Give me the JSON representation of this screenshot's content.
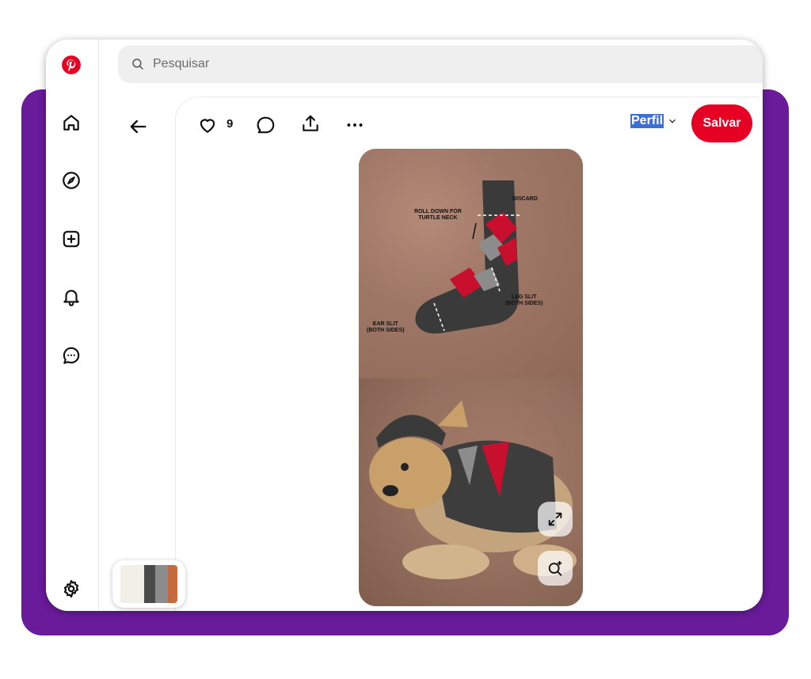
{
  "app": {
    "name": "Pinterest",
    "brand_color": "#e60023",
    "frame_color": "#6a1b9a"
  },
  "search": {
    "placeholder": "Pesquisar",
    "value": ""
  },
  "sidebar": {
    "items": [
      {
        "name": "home",
        "icon": "home-icon"
      },
      {
        "name": "explore",
        "icon": "compass-icon"
      },
      {
        "name": "create",
        "icon": "plus-square-icon"
      },
      {
        "name": "notifications",
        "icon": "bell-icon"
      },
      {
        "name": "messages",
        "icon": "chat-icon"
      },
      {
        "name": "settings",
        "icon": "gear-icon"
      }
    ]
  },
  "pin": {
    "like_count": "9",
    "board_select": "Perfil",
    "save_label": "Salvar",
    "image_labels": {
      "discard": "DISCARD",
      "roll_down": "ROLL DOWN FOR\nTURTLE NECK",
      "leg_slit": "LEG SLIT\n(BOTH SIDES)",
      "ear_slit": "EAR SLIT\n(BOTH SIDES)"
    }
  }
}
